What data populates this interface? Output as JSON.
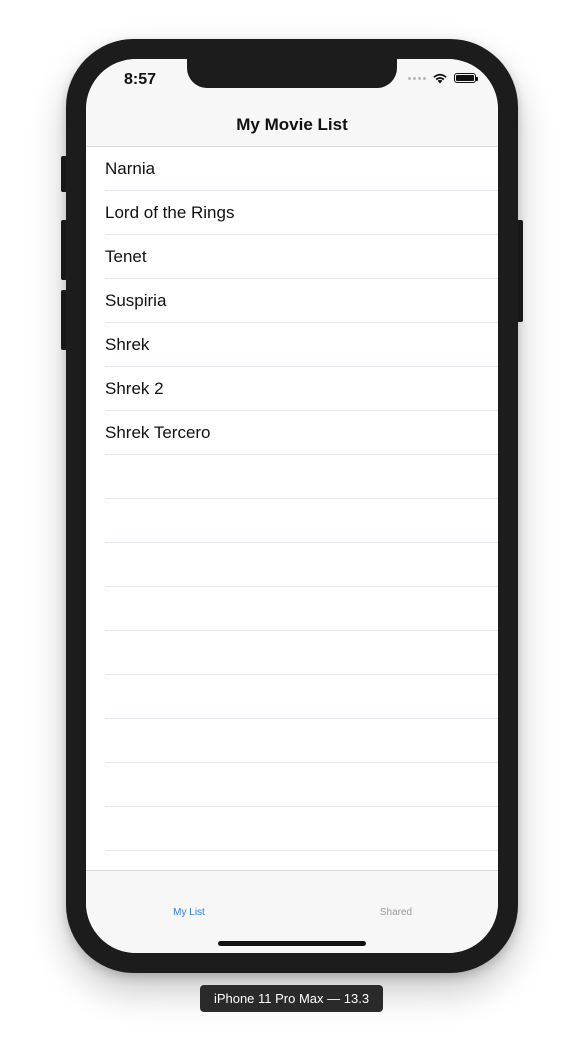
{
  "status_bar": {
    "time": "8:57"
  },
  "nav": {
    "title": "My Movie List"
  },
  "movies": [
    "Narnia",
    "Lord of the Rings",
    "Tenet",
    "Suspiria",
    "Shrek",
    "Shrek 2",
    "Shrek Tercero"
  ],
  "tabs": {
    "my_list": "My List",
    "shared": "Shared"
  },
  "device_label": "iPhone 11 Pro Max — 13.3",
  "colors": {
    "accent": "#2f7fe0",
    "inactive_tab": "#999999",
    "separator": "#e3e8ee"
  }
}
